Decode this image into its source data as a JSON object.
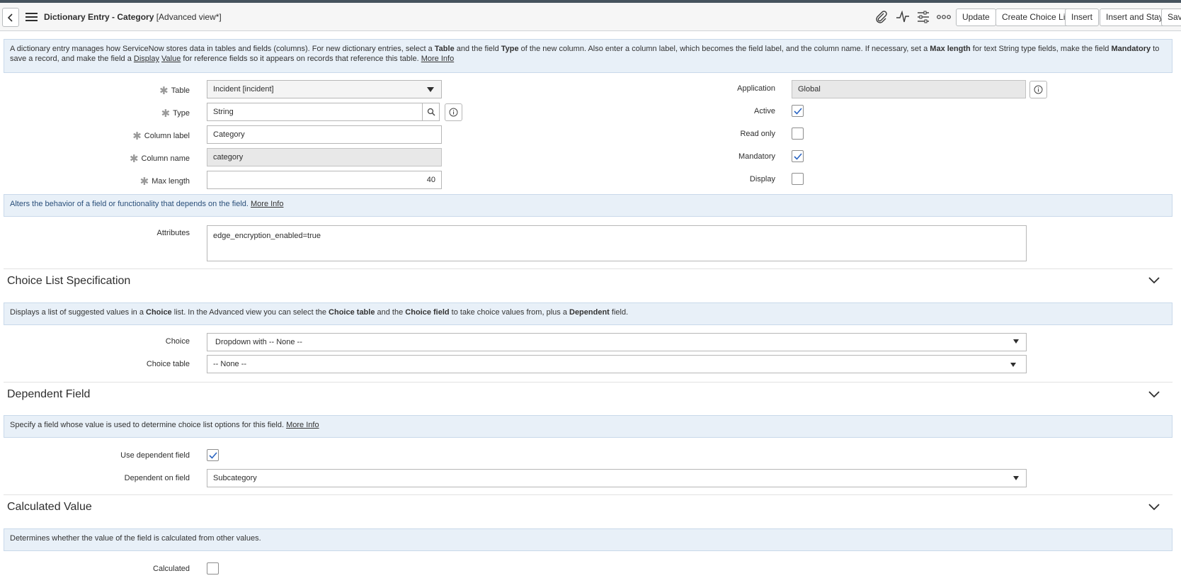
{
  "header": {
    "title_bold": "Dictionary Entry - Category",
    "title_view": "[Advanced view*]",
    "buttons": {
      "update": "Update",
      "create_choice_list": "Create Choice List",
      "insert": "Insert",
      "insert_and_stay": "Insert and Stay",
      "save": "Save"
    }
  },
  "intro_banner": {
    "t1": "A dictionary entry manages how ServiceNow stores data in tables and fields (columns). For new dictionary entries, select a ",
    "b1": "Table",
    "t2": " and the field ",
    "b2": "Type",
    "t3": " of the new column. Also enter a column label, which becomes the field label, and the column name. If necessary, set a ",
    "b3": "Max length",
    "t4": " for text String type fields, make the field ",
    "b4": "Mandatory",
    "t5": " to save a record, and make the field a ",
    "u1": "Display",
    "u2": "Value",
    "t6": " for reference fields so it appears on records that reference this table. ",
    "more": "More Info"
  },
  "form": {
    "table": {
      "label": "Table",
      "value": "Incident [incident]"
    },
    "type": {
      "label": "Type",
      "value": "String"
    },
    "column_label": {
      "label": "Column label",
      "value": "Category"
    },
    "column_name": {
      "label": "Column name",
      "value": "category"
    },
    "max_length": {
      "label": "Max length",
      "value": "40"
    },
    "application": {
      "label": "Application",
      "value": "Global"
    },
    "active": {
      "label": "Active",
      "checked": true
    },
    "read_only": {
      "label": "Read only",
      "checked": false
    },
    "mandatory": {
      "label": "Mandatory",
      "checked": true
    },
    "display": {
      "label": "Display",
      "checked": false
    }
  },
  "attributes_banner": {
    "text": "Alters the behavior of a field or functionality that depends on the field. ",
    "more": "More Info"
  },
  "attributes": {
    "label": "Attributes",
    "value": "edge_encryption_enabled=true"
  },
  "choice_section": {
    "title": "Choice List Specification",
    "banner": {
      "t1": "Displays a list of suggested values in a ",
      "b1": "Choice",
      "t2": " list. In the Advanced view you can select the ",
      "b2": "Choice table",
      "t3": " and the ",
      "b3": "Choice field",
      "t4": " to take choice values from, plus a ",
      "b4": "Dependent",
      "t5": " field."
    },
    "choice": {
      "label": "Choice",
      "value": "Dropdown with -- None --"
    },
    "choice_table": {
      "label": "Choice table",
      "value": "-- None --"
    }
  },
  "dependent_section": {
    "title": "Dependent Field",
    "banner": {
      "text": "Specify a field whose value is used to determine choice list options for this field. ",
      "more": "More Info"
    },
    "use_dependent": {
      "label": "Use dependent field",
      "checked": true
    },
    "dependent_on": {
      "label": "Dependent on field",
      "value": "Subcategory"
    }
  },
  "calculated_section": {
    "title": "Calculated Value",
    "banner": {
      "text": "Determines whether the value of the field is calculated from other values."
    },
    "calculated": {
      "label": "Calculated",
      "checked": false
    }
  }
}
